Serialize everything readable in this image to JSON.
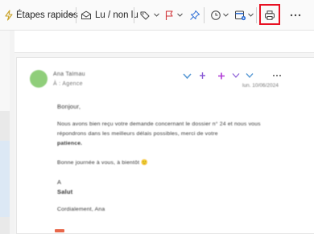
{
  "toolbar": {
    "quick_steps_label": "Étapes rapides",
    "read_unread_label": "Lu / non lu",
    "icons": [
      "lightning-icon",
      "chevron-down-icon",
      "envelope-icon",
      "tag-icon",
      "flag-icon",
      "pin-icon",
      "clock-icon",
      "calendar-icon",
      "print-icon",
      "more-icon"
    ],
    "print_highlight_color": "#e81123"
  },
  "message": {
    "sender": "Ana Talmau",
    "recipient": "À : Agence",
    "date": "lun. 10/06/2024",
    "greeting": "Bonjour,",
    "line1": "Nous avons bien reçu votre demande concernant le dossier n° 24 et nous vous",
    "line2": "répondrons dans les meilleurs délais possibles, merci de votre",
    "line3": "patience.",
    "line4": "Bonne journée à vous, à bientôt 🙂",
    "line5": "A",
    "line6": "Salut",
    "line7": "Cordialement, Ana"
  },
  "colors": {
    "avatar": "#8fce7a",
    "reaction_blue": "#5b9bd5",
    "reaction_purple": "#8a5cd6",
    "accent_purple": "#b03bd6"
  }
}
